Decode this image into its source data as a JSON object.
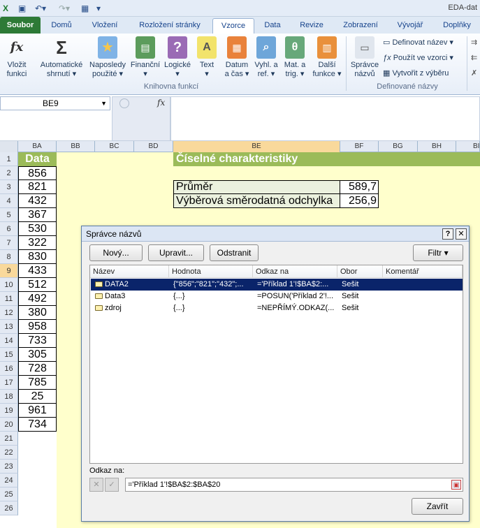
{
  "window": {
    "title": "EDA-dat"
  },
  "tabs": [
    "Soubor",
    "Domů",
    "Vložení",
    "Rozložení stránky",
    "Vzorce",
    "Data",
    "Revize",
    "Zobrazení",
    "Vývojář",
    "Doplňky"
  ],
  "ribbon": {
    "insert_fn": {
      "l1": "Vložit",
      "l2": "funkci"
    },
    "autosum": {
      "l1": "Automatické",
      "l2": "shrnutí ▾"
    },
    "recent": {
      "l1": "Naposledy",
      "l2": "použité ▾"
    },
    "financial": {
      "l1": "Finanční",
      "l2": "▾"
    },
    "logical": {
      "l1": "Logické",
      "l2": "▾"
    },
    "text": {
      "l1": "Text",
      "l2": "▾"
    },
    "datetime": {
      "l1": "Datum",
      "l2": "a čas ▾"
    },
    "lookup": {
      "l1": "Vyhl. a",
      "l2": "ref. ▾"
    },
    "mathtrig": {
      "l1": "Mat. a",
      "l2": "trig. ▾"
    },
    "more": {
      "l1": "Další",
      "l2": "funkce ▾"
    },
    "group_library": "Knihovna funkcí",
    "name_manager": {
      "l1": "Správce",
      "l2": "názvů"
    },
    "define_name": "Definovat název ▾",
    "use_in_formula": "Použít ve vzorci ▾",
    "create_from_sel": "Vytvořit z výběru",
    "group_names": "Definované názvy"
  },
  "formula_bar": {
    "namebox": "BE9",
    "fx": "fx"
  },
  "columns": [
    "BA",
    "BB",
    "BC",
    "BD",
    "BE",
    "BF",
    "BG",
    "BH",
    "BI"
  ],
  "rows": [
    "1",
    "2",
    "3",
    "4",
    "5",
    "6",
    "7",
    "8",
    "9",
    "10",
    "11",
    "12",
    "13",
    "14",
    "15",
    "16",
    "17",
    "18",
    "19",
    "20",
    "21",
    "22",
    "23",
    "24",
    "25",
    "26"
  ],
  "sheet": {
    "data_header": "Data",
    "values": [
      "856",
      "821",
      "432",
      "367",
      "530",
      "322",
      "830",
      "433",
      "512",
      "492",
      "380",
      "958",
      "733",
      "305",
      "728",
      "785",
      "25",
      "961",
      "734"
    ],
    "stats_title": "Číselné charakteristiky",
    "mean_label": "Průměr",
    "mean_value": "589,7",
    "sd_label": "Výběrová směrodatná odchylka",
    "sd_value": "256,9"
  },
  "dialog": {
    "title": "Správce názvů",
    "help": "?",
    "close_x": "✕",
    "new_btn": "Nový...",
    "edit_btn": "Upravit...",
    "delete_btn": "Odstranit",
    "filter_btn": "Filtr ▾",
    "headers": [
      "Název",
      "Hodnota",
      "Odkaz na",
      "Obor",
      "Komentář"
    ],
    "items": [
      {
        "name": "DATA2",
        "value": "{\"856\";\"821\";\"432\";...",
        "ref": "='Příklad 1'!$BA$2:...",
        "scope": "Sešit"
      },
      {
        "name": "Data3",
        "value": "{...}",
        "ref": "=POSUN('Příklad 2'!...",
        "scope": "Sešit"
      },
      {
        "name": "zdroj",
        "value": "{...}",
        "ref": "=NEPŘÍMÝ.ODKAZ(...",
        "scope": "Sešit"
      }
    ],
    "refers_label": "Odkaz na:",
    "refers_value": "='Příklad 1'!$BA$2:$BA$20",
    "close_btn": "Zavřít"
  },
  "colors": {
    "green_header": "#9bbb59",
    "yellow": "#ffffcc",
    "selection": "#0a246a"
  }
}
